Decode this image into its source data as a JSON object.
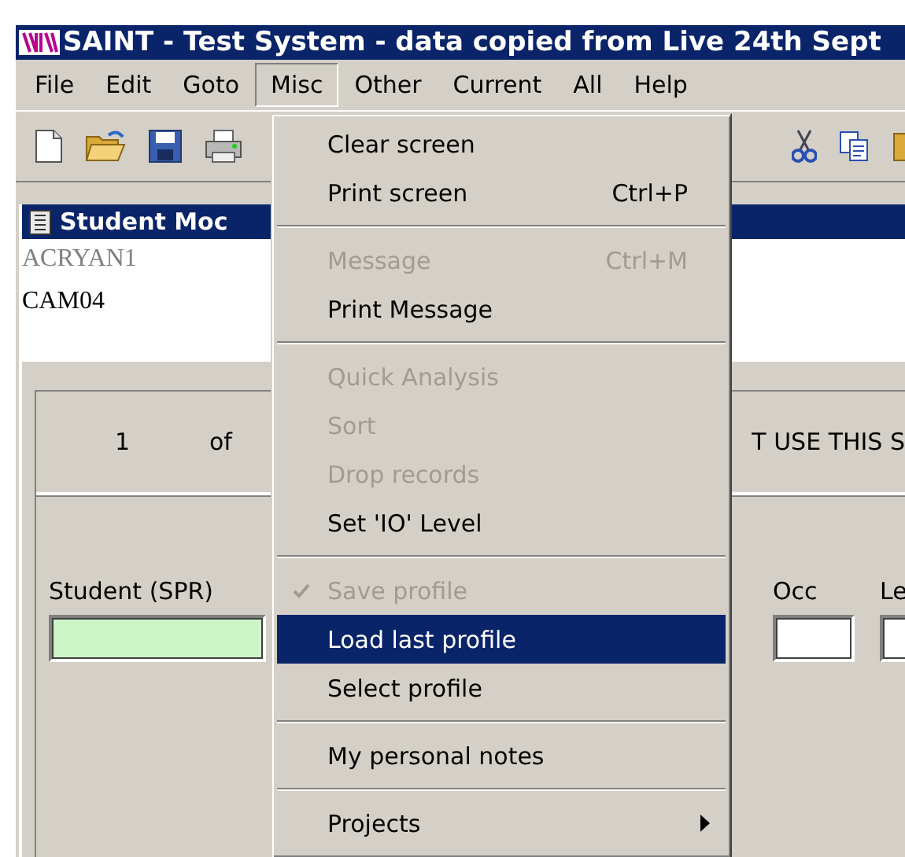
{
  "window": {
    "title": "SAINT - Test System - data copied from Live 24th Sept"
  },
  "menu_bar": [
    {
      "label": "File",
      "selected": false
    },
    {
      "label": "Edit",
      "selected": false
    },
    {
      "label": "Goto",
      "selected": false
    },
    {
      "label": "Misc",
      "selected": true
    },
    {
      "label": "Other",
      "selected": false
    },
    {
      "label": "Current",
      "selected": false
    },
    {
      "label": "All",
      "selected": false
    },
    {
      "label": "Help",
      "selected": false
    }
  ],
  "child_window": {
    "title": "Student Moc",
    "lines": [
      {
        "text": "ACRYAN1",
        "disabled": true
      },
      {
        "text": "CAM04",
        "disabled": false
      }
    ],
    "record_counter": {
      "current": "1",
      "of": "of"
    },
    "banner": "T USE THIS S",
    "fields": [
      {
        "label": "Student (SPR)",
        "color": "#ccf5c8"
      },
      {
        "label": "Occ",
        "color": "#ffffff"
      },
      {
        "label": "Le",
        "color": "#ffffff"
      }
    ]
  },
  "dropdown_menu": {
    "groups": [
      [
        {
          "label": "Clear screen",
          "disabled": false,
          "checked": false,
          "selected": false,
          "submenu": false
        },
        {
          "label": "Print screen",
          "shortcut": "Ctrl+P",
          "disabled": false,
          "checked": false,
          "selected": false,
          "submenu": false
        }
      ],
      [
        {
          "label": "Message",
          "shortcut": "Ctrl+M",
          "disabled": true,
          "checked": false,
          "selected": false,
          "submenu": false
        },
        {
          "label": "Print Message",
          "disabled": false,
          "checked": false,
          "selected": false,
          "submenu": false
        }
      ],
      [
        {
          "label": "Quick Analysis",
          "disabled": true,
          "checked": false,
          "selected": false,
          "submenu": false
        },
        {
          "label": "Sort",
          "disabled": true,
          "checked": false,
          "selected": false,
          "submenu": false
        },
        {
          "label": "Drop records",
          "disabled": true,
          "checked": false,
          "selected": false,
          "submenu": false
        },
        {
          "label": "Set 'IO' Level",
          "disabled": false,
          "checked": false,
          "selected": false,
          "submenu": false
        }
      ],
      [
        {
          "label": "Save profile",
          "disabled": true,
          "checked": true,
          "selected": false,
          "submenu": false
        },
        {
          "label": "Load last profile",
          "disabled": false,
          "checked": false,
          "selected": true,
          "submenu": false
        },
        {
          "label": "Select profile",
          "disabled": false,
          "checked": false,
          "selected": false,
          "submenu": false
        }
      ],
      [
        {
          "label": "My personal notes",
          "disabled": false,
          "checked": false,
          "selected": false,
          "submenu": false
        }
      ],
      [
        {
          "label": "Projects",
          "disabled": false,
          "checked": false,
          "selected": false,
          "submenu": true
        }
      ]
    ]
  }
}
